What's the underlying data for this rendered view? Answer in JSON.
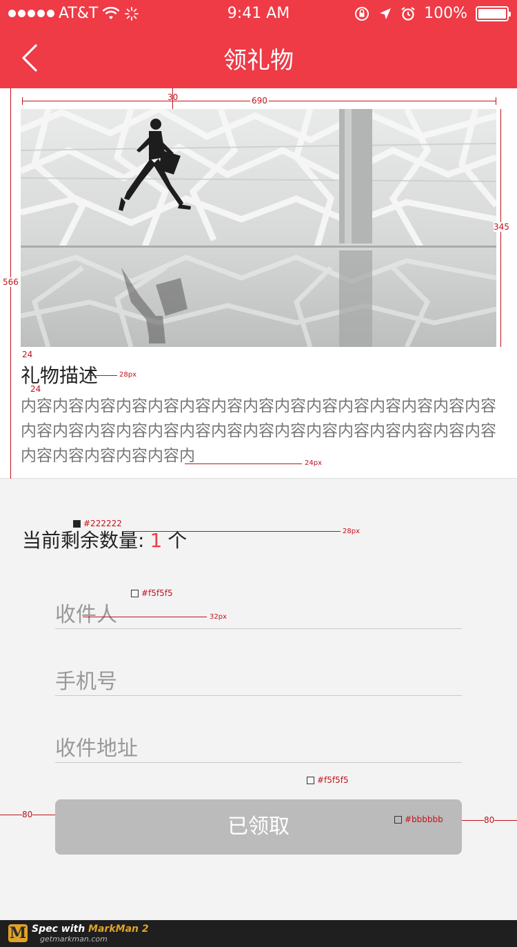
{
  "status_bar": {
    "carrier": "AT&T",
    "time": "9:41 AM",
    "battery": "100%"
  },
  "nav": {
    "title": "领礼物"
  },
  "gift": {
    "title": "礼物描述",
    "description": "内容内容内容内容内容内容内容内容内容内容内容内容内容内容内容内容内容内容内容内容内容内容内容内容内容内容内容内容内容内容内容内容内容内容内容内"
  },
  "remaining": {
    "label": "当前剩余数量:",
    "count": "1",
    "unit": "个"
  },
  "form": {
    "recipient_placeholder": "收件人",
    "phone_placeholder": "手机号",
    "address_placeholder": "收件地址",
    "submit_label": "已领取"
  },
  "annotations": {
    "top_margin": "30",
    "image_width": "690",
    "image_height": "345",
    "card_height": "566",
    "gap1": "24",
    "gap2": "24",
    "title_size": "28px",
    "desc_size": "24px",
    "color_text": "#222222",
    "remain_size": "28px",
    "color_bg1": "#f5f5f5",
    "field_size": "32px",
    "color_bg2": "#f5f5f5",
    "color_btn": "#bbbbbb",
    "left_margin": "80",
    "right_margin": "80"
  },
  "footer": {
    "brand_prefix": "Spec with ",
    "brand_name": "MarkMan 2",
    "site": "getmarkman.com"
  },
  "colors": {
    "accent": "#ee3b46",
    "button": "#bbbbbb",
    "background": "#f3f3f3"
  }
}
